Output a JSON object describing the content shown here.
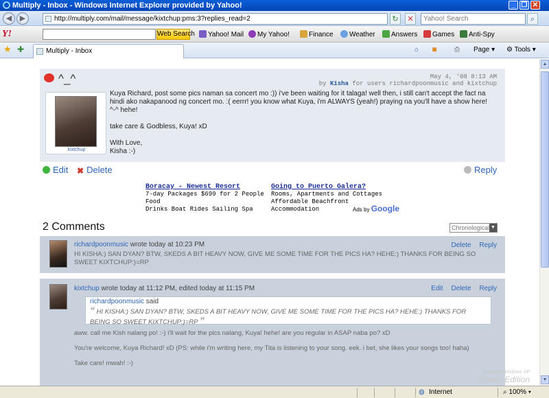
{
  "window": {
    "title": "Multiply - Inbox - Windows Internet Explorer provided by Yahoo!"
  },
  "address": {
    "url": "http://multiply.com/mail/message/kixtchup:pms:3?replies_read=2",
    "search_placeholder": "Yahoo! Search"
  },
  "yahoo_toolbar": {
    "logo": "Y!",
    "web_search": "Web Search",
    "items": [
      "Yahoo! Mail",
      "My Yahoo!",
      "Finance",
      "Weather",
      "Answers",
      "Games",
      "Anti-Spy"
    ]
  },
  "favorites_bar": {
    "tab_title": "Multiply - Inbox",
    "page_label": "Page",
    "tools_label": "Tools"
  },
  "message": {
    "subject": "^_^",
    "date": "May 4, '08 8:13 AM",
    "by_prefix": "by ",
    "author": "Kisha",
    "recipients": " for users richardpoonmusic and kixtchup",
    "avatar_name": "kixtchup",
    "paragraphs": [
      "Kuya Richard, post some pics naman sa concert mo :)) i've been waiting for it talaga! well then, i still can't accept the fact na hindi ako nakapanood ng concert mo. :( eerrr! you know what Kuya, i'm ALWAYS (yeah!) praying na you'll have a show here! ^-^ hehe!",
      "take care & Godbless, Kuya! xD",
      "With Love,",
      "Kisha :-)"
    ],
    "actions": {
      "edit": "Edit",
      "delete": "Delete",
      "reply": "Reply"
    }
  },
  "ads": [
    {
      "title": "Boracay - Newest Resort",
      "line1": "7-day Packages $699 for 2 People Food",
      "line2": "Drinks Boat Rides Sailing Spa"
    },
    {
      "title": "Going to Puerto Galera?",
      "line1": "Rooms, Apartments and Cottages",
      "line2": "Affordable Beachfront Accommodation"
    }
  ],
  "ads_by": {
    "prefix": "Ads by",
    "brand": "Google"
  },
  "comments": {
    "title": "2 Comments",
    "sort": "Chronological",
    "items": [
      {
        "user": "richardpoonmusic",
        "meta": " wrote today at 10:23 PM",
        "links": [
          "Delete",
          "Reply"
        ],
        "text": "HI KISHA:) SAN DYAN? BTW, SKEDS A BIT HEAVY NOW, GIVE ME SOME TIME FOR THE PICS HA? HEHE:) THANKS FOR BEING SO SWEET KIXTCHUP:)=RP"
      },
      {
        "user": "kixtchup",
        "meta": " wrote today at 11:12 PM, edited today at 11:15 PM",
        "links": [
          "Edit",
          "Delete",
          "Reply"
        ],
        "quote_user": "richardpoonmusic",
        "quote_said": " said",
        "quote_open": "“",
        "quote_close": "”",
        "quote_text": "HI KISHA:) SAN DYAN? BTW, SKEDS A BIT HEAVY NOW, GIVE ME SOME TIME FOR THE PICS HA? HEHE:) THANKS FOR BEING SO SWEET KIXTCHUP:)=RP",
        "lines": [
          "aww. call me Kish nalang po! :-) i'll wait for the pics nalang, Kuya! hehe! are you regular in ASAP naba po? xD",
          "You're welcome, Kuya Richard! xD (PS: while i'm writing here, my Tita is listening to your song. eek. i bet, she likes your songs too! haha)",
          "Take care! mwah! :-)"
        ]
      }
    ]
  },
  "status": {
    "zone": "Internet",
    "zoom": "100%"
  },
  "watermark": {
    "line1": "Microsoft Windows XP",
    "line2": "Starter Edition"
  },
  "colors": {
    "title_bar": "#0a5fd8",
    "link": "#2e66b8",
    "comment_bg": "#c8d1dc",
    "message_bg": "#e6ebf2",
    "yahoo_red": "#c4002b"
  }
}
